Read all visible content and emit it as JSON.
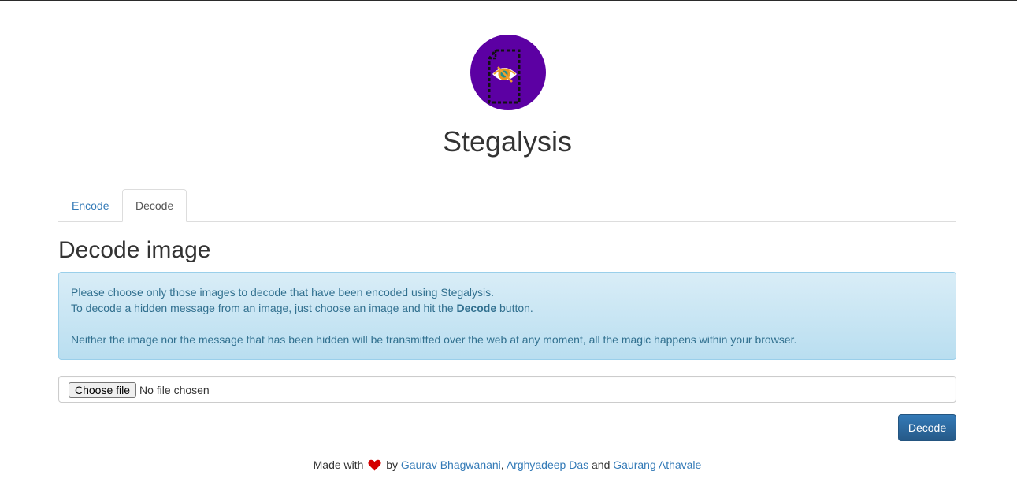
{
  "app": {
    "title": "Stegalysis"
  },
  "tabs": [
    {
      "label": "Encode",
      "active": false
    },
    {
      "label": "Decode",
      "active": true
    }
  ],
  "main": {
    "heading": "Decode image",
    "alert": {
      "line1": "Please choose only those images to decode that have been encoded using Stegalysis.",
      "line2_before": "To decode a hidden message from an image, just choose an image and hit the ",
      "line2_bold": "Decode",
      "line2_after": " button.",
      "line3": "Neither the image nor the message that has been hidden will be transmitted over the web at any moment, all the magic happens within your browser."
    },
    "file_input": {
      "button_label": "Choose file",
      "status": "No file chosen"
    },
    "decode_button": "Decode"
  },
  "footer": {
    "made_with": "Made with",
    "by": "by",
    "authors": [
      "Gaurav Bhagwanani",
      "Arghyadeep Das",
      "Gaurang Athavale"
    ],
    "separator": ",",
    "and": "and"
  },
  "colors": {
    "logo_bg": "#5c00a3",
    "link": "#337ab7",
    "alert_text": "#31708f",
    "primary_button": "#337ab7",
    "heart": "#d40000"
  },
  "icons": {
    "logo": "eye-document-logo-icon",
    "heart": "heart-icon"
  }
}
